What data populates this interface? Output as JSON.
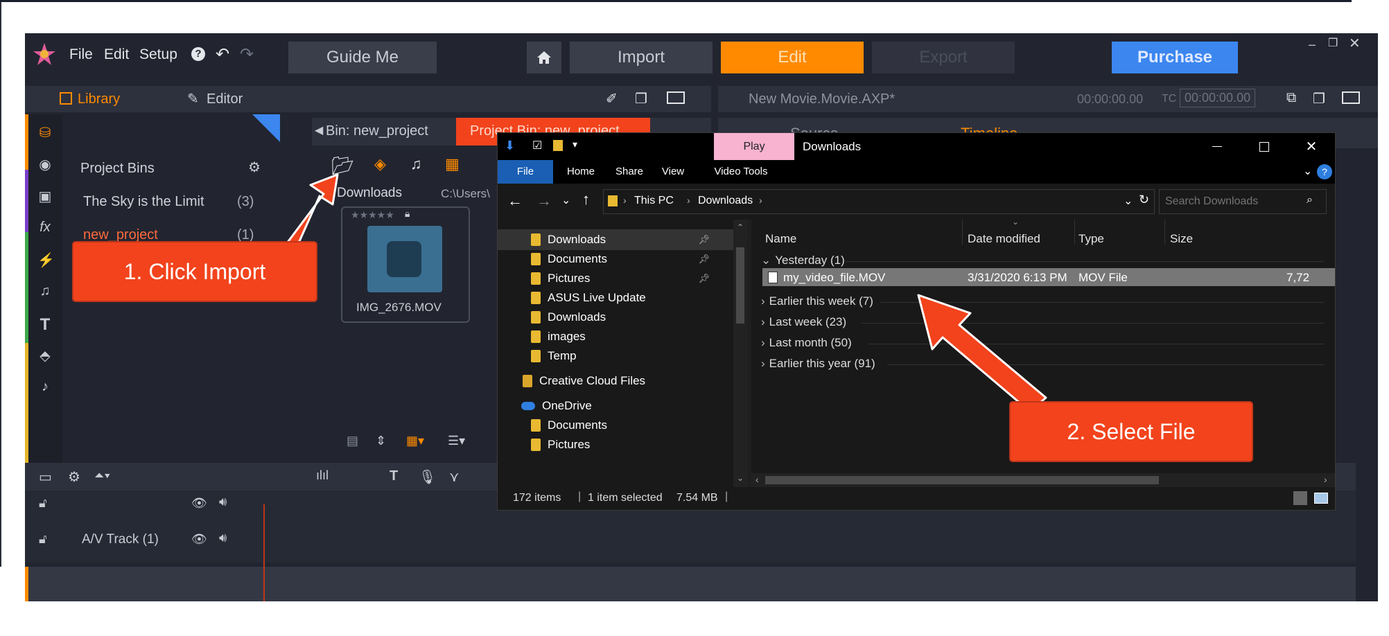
{
  "app": {
    "menu": [
      "File",
      "Edit",
      "Setup"
    ],
    "guide_me": "Guide Me",
    "import": "Import",
    "edit": "Edit",
    "export": "Export",
    "purchase": "Purchase",
    "library_tab": "Library",
    "editor_tab": "Editor",
    "movie_title": "New Movie.Movie.AXP*",
    "timecode_1": "00:00:00.00",
    "tc_label": "TC",
    "timecode_2": "00:00:00.00",
    "source_tab": "Source",
    "timeline_tab": "Timeline",
    "bin_tab": "Bin: new_project",
    "project_bin_tab": "Project Bin: new_project",
    "project_bins_label": "Project Bins",
    "bins": [
      {
        "name": "The Sky is the Limit",
        "count": "(3)"
      },
      {
        "name": "new_project",
        "count": "(1)"
      }
    ],
    "breadcrumb_folder": "Downloads",
    "breadcrumb_path": "C:\\Users\\",
    "media_name": "IMG_2676.MOV",
    "track_label": "A/V Track (1)",
    "colors": {
      "orange": "#ff8a00",
      "purchase": "#3c86f0",
      "callout": "#f2431c"
    }
  },
  "explorer": {
    "play_tab": "Play",
    "title": "Downloads",
    "ribbon": [
      "File",
      "Home",
      "Share",
      "View",
      "Video Tools"
    ],
    "help": "?",
    "address": [
      "This PC",
      "Downloads"
    ],
    "search_placeholder": "Search Downloads",
    "nav": [
      {
        "label": "Downloads",
        "pinned": true
      },
      {
        "label": "Documents",
        "pinned": true
      },
      {
        "label": "Pictures",
        "pinned": true
      },
      {
        "label": "ASUS Live Update",
        "pinned": false
      },
      {
        "label": "Downloads",
        "pinned": false
      },
      {
        "label": "images",
        "pinned": false
      },
      {
        "label": "Temp",
        "pinned": false
      },
      {
        "label": "Creative Cloud Files",
        "pinned": false
      },
      {
        "label": "OneDrive",
        "pinned": false
      },
      {
        "label": "Documents",
        "pinned": false
      },
      {
        "label": "Pictures",
        "pinned": false
      }
    ],
    "columns": [
      "Name",
      "Date modified",
      "Type",
      "Size"
    ],
    "groups": [
      {
        "label": "Yesterday (1)",
        "expanded": true
      },
      {
        "label": "Earlier this week (7)",
        "expanded": false
      },
      {
        "label": "Last week (23)",
        "expanded": false
      },
      {
        "label": "Last month (50)",
        "expanded": false
      },
      {
        "label": "Earlier this year (91)",
        "expanded": false
      }
    ],
    "file": {
      "name": "my_video_file.MOV",
      "date": "3/31/2020 6:13 PM",
      "type": "MOV File",
      "size": "7,72"
    },
    "status": {
      "count": "172 items",
      "selected": "1 item selected",
      "size": "7.54 MB"
    }
  },
  "annotations": {
    "step1": "1. Click Import",
    "step2": "2. Select File"
  }
}
